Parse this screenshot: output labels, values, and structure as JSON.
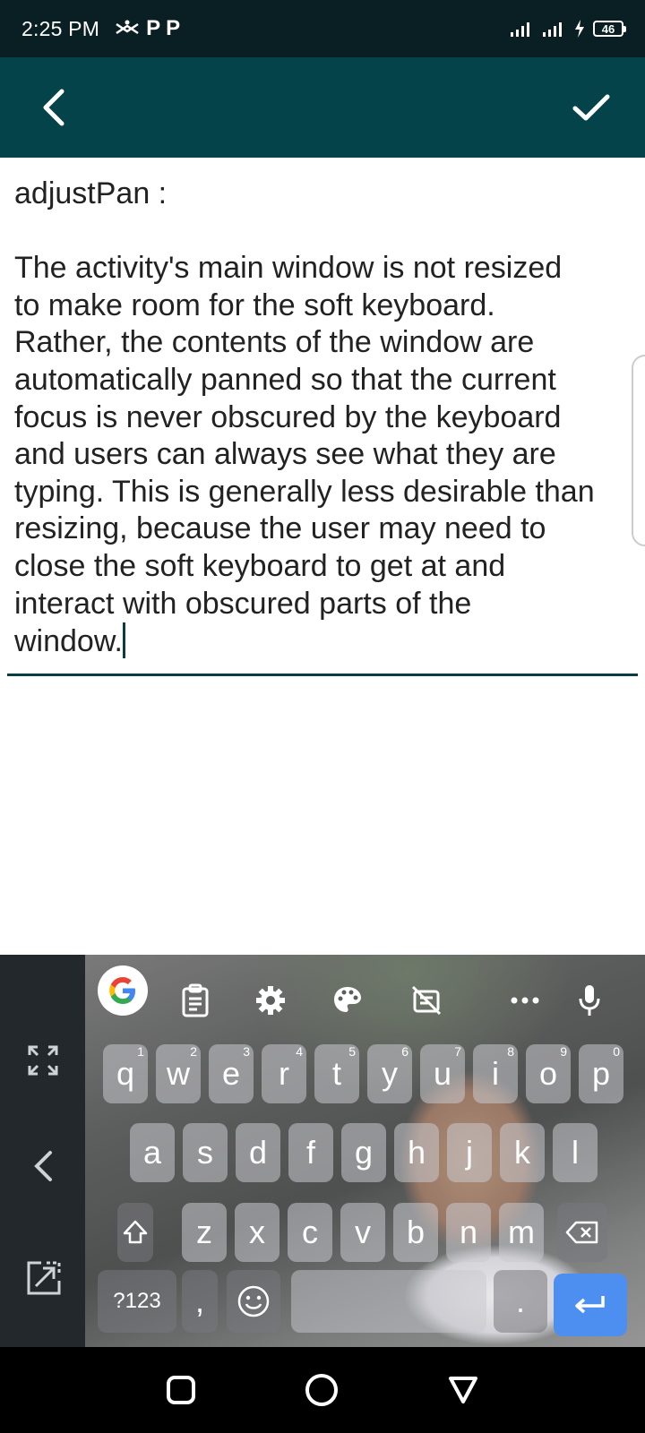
{
  "status_bar": {
    "time": "2:25 PM",
    "notif1": "P",
    "notif2": "P",
    "battery": "46"
  },
  "app_bar": {
    "back_icon": "chevron-left-icon",
    "confirm_icon": "check-icon"
  },
  "editor": {
    "lines": [
      "adjustPan :",
      "",
      "The activity's main window is not resized",
      "to make room for the soft keyboard.",
      "Rather, the contents of the window are",
      "automatically panned so that the current",
      "focus is never obscured by the keyboard",
      "and users can always see what they are",
      "typing. This is generally less desirable than",
      "resizing, because the user may need to",
      "close the soft keyboard to get at and",
      "interact with obscured parts of the",
      "window."
    ]
  },
  "keyboard": {
    "row1": [
      {
        "k": "q",
        "h": "1"
      },
      {
        "k": "w",
        "h": "2"
      },
      {
        "k": "e",
        "h": "3"
      },
      {
        "k": "r",
        "h": "4"
      },
      {
        "k": "t",
        "h": "5"
      },
      {
        "k": "y",
        "h": "6"
      },
      {
        "k": "u",
        "h": "7"
      },
      {
        "k": "i",
        "h": "8"
      },
      {
        "k": "o",
        "h": "9"
      },
      {
        "k": "p",
        "h": "0"
      }
    ],
    "row2": [
      "a",
      "s",
      "d",
      "f",
      "g",
      "h",
      "j",
      "k",
      "l"
    ],
    "row3": [
      "z",
      "x",
      "c",
      "v",
      "b",
      "n",
      "m"
    ],
    "symbols_label": "?123",
    "comma": ",",
    "period": "."
  }
}
